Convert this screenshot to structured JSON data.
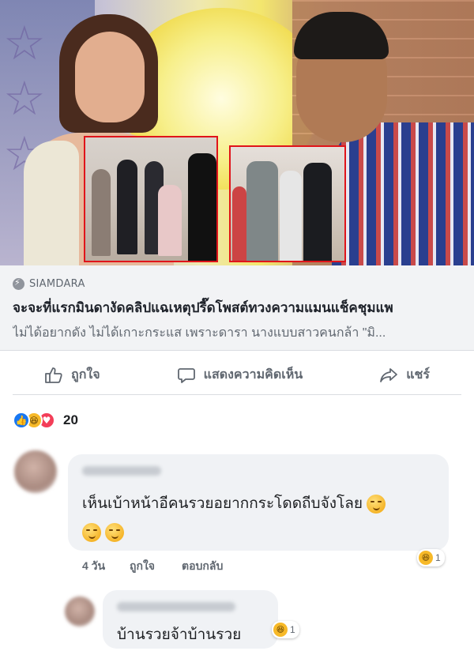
{
  "link_preview": {
    "source": "SIAMDARA",
    "headline": "จะจะที่แรกมินดางัดคลิปแฉเหตุปรี๊ดโพสต์ทวงความแมนแช็คชุมแพ",
    "description": "ไม่ได้อยากดัง ไม่ได้เกาะกระแส เพราะดารา นางแบบสาวคนกล้า \"มิ..."
  },
  "actions": {
    "like_label": "ถูกใจ",
    "comment_label": "แสดงความคิดเห็น",
    "share_label": "แชร์"
  },
  "reactions": {
    "count": "20",
    "types": [
      "like",
      "haha",
      "love"
    ]
  },
  "comments": [
    {
      "text": "เห็นเบ้าหน้าอีคนรวยอยากกระโดดถีบจังโลย",
      "time": "4 วัน",
      "like_label": "ถูกใจ",
      "reply_label": "ตอบกลับ",
      "reaction_count": "1"
    },
    {
      "text": "บ้านรวยจ้าบ้านรวย",
      "reaction_count": "1"
    }
  ],
  "colors": {
    "facebook_blue": "#1877f2",
    "inset_border": "#e0141a",
    "bubble_bg": "#f0f2f5",
    "muted_text": "#606770"
  }
}
